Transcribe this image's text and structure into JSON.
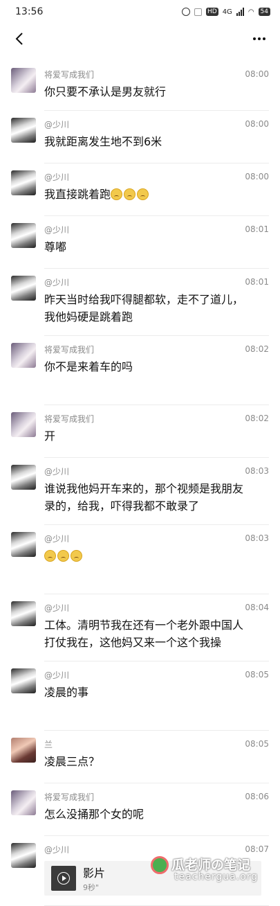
{
  "status_bar": {
    "time": "13:56",
    "network": "4G",
    "battery": "54"
  },
  "messages": [
    {
      "avatar": "cat",
      "name": "将爱写成我们",
      "time": "08:00",
      "text": "你只要不承认是男友就行"
    },
    {
      "avatar": "boy",
      "name": "@少川",
      "time": "08:00",
      "text": "我就距离发生地不到6米"
    },
    {
      "avatar": "boy",
      "name": "@少川",
      "time": "08:00",
      "text": "我直接跳着跑",
      "emoji_count": 3
    },
    {
      "avatar": "boy",
      "name": "@少川",
      "time": "08:01",
      "text": "尊嘟"
    },
    {
      "avatar": "boy",
      "name": "@少川",
      "time": "08:01",
      "text": "昨天当时给我吓得腿都软，走不了道儿，\n我他妈硬是跳着跑"
    },
    {
      "avatar": "cat",
      "name": "将爱写成我们",
      "time": "08:02",
      "text": "你不是来着车的吗"
    },
    {
      "avatar": "cat",
      "name": "将爱写成我们",
      "time": "08:02",
      "text": "开"
    },
    {
      "avatar": "boy",
      "name": "@少川",
      "time": "08:03",
      "text": "谁说我他妈开车来的，那个视频是我朋友\n录的，给我，吓得我都不敢录了"
    },
    {
      "avatar": "boy",
      "name": "@少川",
      "time": "08:03",
      "text": "",
      "emoji_count": 3
    },
    {
      "avatar": "boy",
      "name": "@少川",
      "time": "08:04",
      "text": "工体。清明节我在还有一个老外跟中国人\n打仗我在，这他妈又来一个这个我操"
    },
    {
      "avatar": "boy",
      "name": "@少川",
      "time": "08:05",
      "text": "凌晨的事"
    },
    {
      "avatar": "girl",
      "name": "兰",
      "time": "08:05",
      "text": "凌晨三点？"
    },
    {
      "avatar": "cat",
      "name": "将爱写成我们",
      "time": "08:06",
      "text": "怎么没捅那个女的呢"
    },
    {
      "avatar": "boy",
      "name": "@少川",
      "time": "08:07",
      "video": {
        "title": "影片",
        "duration": "9秒\""
      }
    }
  ],
  "watermark": {
    "title": "瓜老师の笔记",
    "url": "teachergua.org"
  }
}
